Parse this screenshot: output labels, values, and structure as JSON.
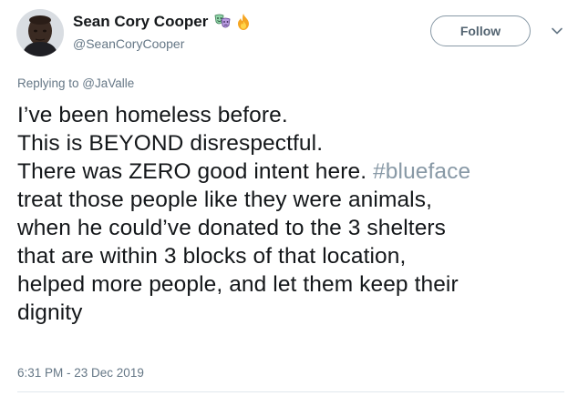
{
  "author": {
    "display_name": "Sean Cory Cooper",
    "handle": "@SeanCoryCooper",
    "emojis": [
      "theater-masks-icon",
      "fire-icon"
    ]
  },
  "actions": {
    "follow_label": "Follow"
  },
  "reply": {
    "prefix": "Replying to ",
    "handle": "@JaValle"
  },
  "tweet": {
    "lines": [
      "I’ve been homeless before.",
      "This is BEYOND disrespectful.",
      "There was ZERO good intent here.",
      "treat those people like they were animals,",
      "when he could’ve donated to the 3 shelters",
      "that are within 3 blocks of that location,",
      "helped more people, and let them keep their",
      "dignity"
    ],
    "hashtag": "#blueface",
    "timestamp": "6:31 PM - 23 Dec 2019"
  },
  "colors": {
    "text": "#14171a",
    "muted": "#657786",
    "hashtag": "#8899a6",
    "border": "#8899a6"
  }
}
